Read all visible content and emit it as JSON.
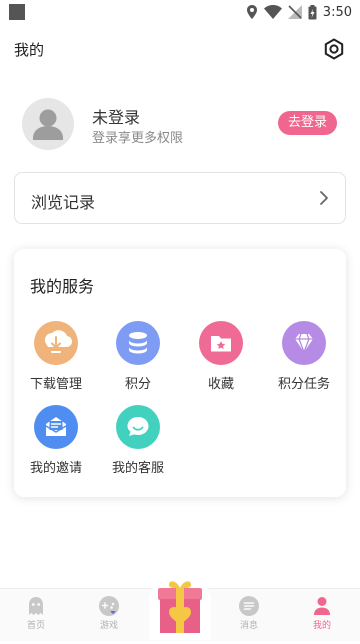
{
  "status_bar": {
    "time": "3:50"
  },
  "header": {
    "title": "我的"
  },
  "profile": {
    "name": "未登录",
    "subtitle": "登录享更多权限",
    "login_button": "去登录"
  },
  "history": {
    "label": "浏览记录"
  },
  "services": {
    "title": "我的服务",
    "items": [
      {
        "label": "下载管理",
        "icon": "download-icon",
        "color": "#f0b37a"
      },
      {
        "label": "积分",
        "icon": "coins-icon",
        "color": "#7f9cf5"
      },
      {
        "label": "收藏",
        "icon": "favorite-folder-icon",
        "color": "#ef6b95"
      },
      {
        "label": "积分任务",
        "icon": "diamond-icon",
        "color": "#b58be6"
      },
      {
        "label": "我的邀请",
        "icon": "mail-icon",
        "color": "#4f8ef0"
      },
      {
        "label": "我的客服",
        "icon": "chat-icon",
        "color": "#43d1bf"
      }
    ]
  },
  "bottom_nav": {
    "items": [
      {
        "label": "首页",
        "icon": "ghost-icon"
      },
      {
        "label": "游戏",
        "icon": "gamepad-icon"
      },
      {
        "label": "",
        "icon": "gift-icon"
      },
      {
        "label": "消息",
        "icon": "message-icon"
      },
      {
        "label": "我的",
        "icon": "person-icon",
        "active": true
      }
    ]
  },
  "colors": {
    "accent": "#f0668f",
    "inactive": "#c8c8c8"
  }
}
